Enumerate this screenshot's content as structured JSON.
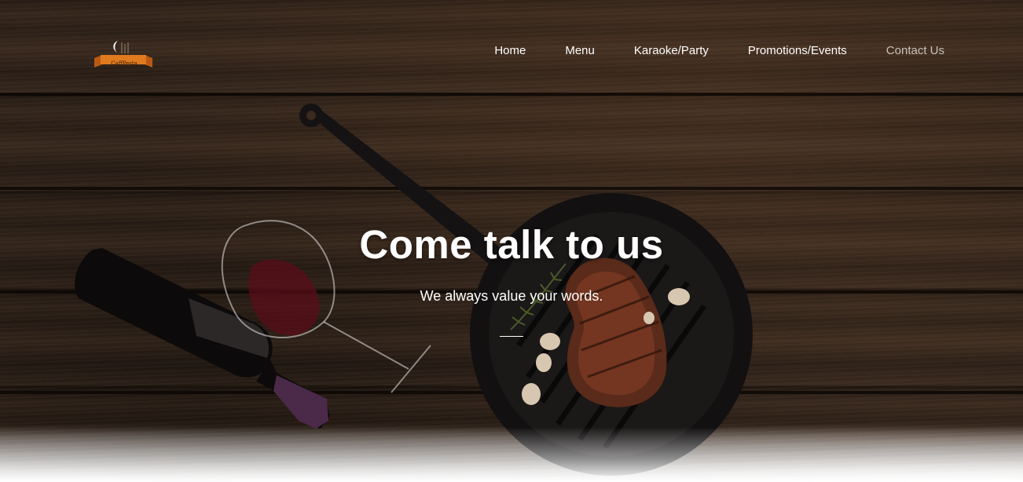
{
  "brand": {
    "logo_text": "CaffPesta",
    "logo_icon": "moon-cup-logo-icon"
  },
  "nav": {
    "items": [
      {
        "label": "Home",
        "active": false
      },
      {
        "label": "Menu",
        "active": false
      },
      {
        "label": "Karaoke/Party",
        "active": false
      },
      {
        "label": "Promotions/Events",
        "active": false
      },
      {
        "label": "Contact Us",
        "active": true
      }
    ]
  },
  "hero": {
    "title": "Come talk to us",
    "subtitle": "We always value your words.",
    "background": "wood-table-steak-wine"
  },
  "colors": {
    "text": "#ffffff",
    "active_nav": "#c9c3bd",
    "logo_accent": "#e07a1f",
    "wood_dark": "#2a1e16"
  }
}
